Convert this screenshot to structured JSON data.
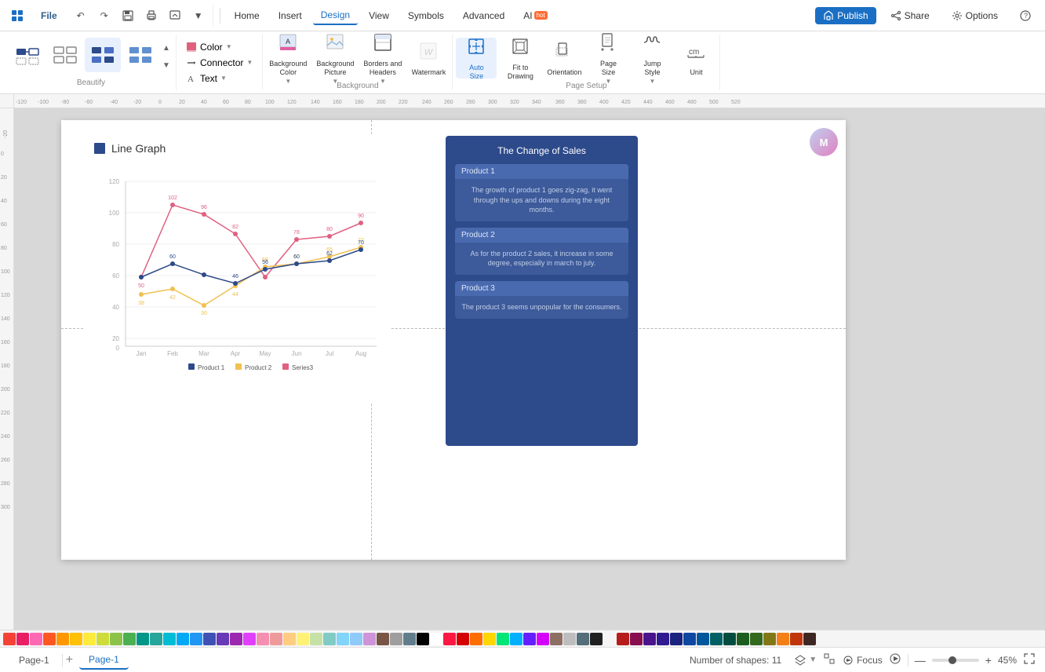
{
  "menubar": {
    "file": "File",
    "items": [
      "Home",
      "Insert",
      "Design",
      "View",
      "Symbols",
      "Advanced",
      "AI"
    ],
    "active": "Design",
    "ai_badge": "hot",
    "actions": {
      "publish": "Publish",
      "share": "Share",
      "options": "Options",
      "help": "?"
    }
  },
  "toolbar": {
    "beautify_label": "Beautify",
    "background_label": "Background",
    "page_setup_label": "Page Setup",
    "color_label": "Color",
    "connector_label": "Connector",
    "text_label": "Text",
    "bg_color_label": "Background\nColor",
    "bg_picture_label": "Background\nPicture",
    "borders_headers_label": "Borders and\nHeaders",
    "watermark_label": "Watermark",
    "auto_size_label": "Auto\nSize",
    "fit_to_drawing_label": "Fit to\nDrawing",
    "orientation_label": "Orientation",
    "page_size_label": "Page\nSize",
    "jump_style_label": "Jump\nStyle",
    "unit_label": "Unit"
  },
  "canvas": {
    "line_graph_title": "Line Graph",
    "chart": {
      "x_labels": [
        "Jan",
        "Feb",
        "Mar",
        "Apr",
        "May",
        "Jun",
        "Jul",
        "Aug"
      ],
      "y_max": 120,
      "series": [
        {
          "name": "Product 1",
          "color": "#e06080",
          "points": [
            50,
            102,
            96,
            82,
            50,
            78,
            80,
            90
          ]
        },
        {
          "name": "Product 2",
          "color": "#f0c050",
          "points": [
            38,
            42,
            30,
            44,
            58,
            60,
            65,
            72
          ]
        },
        {
          "name": "Series3",
          "color": "#c060c0",
          "points": [
            50,
            60,
            52,
            46,
            56,
            60,
            62,
            70
          ]
        }
      ]
    },
    "info_card": {
      "title": "The Change of Sales",
      "products": [
        {
          "label": "Product 1",
          "desc": "The growth of product 1 goes zig-zag, it went through the ups and downs during the eight months."
        },
        {
          "label": "Product 2",
          "desc": "As for the product 2 sales, it increase in some degree, especially in march to july."
        },
        {
          "label": "Product 3",
          "desc": "The product 3 seems unpopular for the consumers."
        }
      ]
    }
  },
  "status_bar": {
    "page_tab": "Page-1",
    "active_tab": "Page-1",
    "shapes_count": "Number of shapes: 11",
    "focus": "Focus",
    "zoom": "45%"
  },
  "colors": [
    "#f44336",
    "#e91e63",
    "#ff69b4",
    "#ff5722",
    "#ff9800",
    "#ffc107",
    "#ffeb3b",
    "#cddc39",
    "#8bc34a",
    "#4caf50",
    "#009688",
    "#26a69a",
    "#00bcd4",
    "#03a9f4",
    "#2196f3",
    "#3f51b5",
    "#673ab7",
    "#9c27b0",
    "#e040fb",
    "#f48fb1",
    "#ef9a9a",
    "#ffcc80",
    "#fff176",
    "#c5e1a5",
    "#80cbc4",
    "#81d4fa",
    "#90caf9",
    "#ce93d8",
    "#795548",
    "#9e9e9e",
    "#607d8b",
    "#000000",
    "#ffffff",
    "#ff1744",
    "#d50000",
    "#ff6d00",
    "#ffd600",
    "#00e676",
    "#00b0ff",
    "#651fff",
    "#d500f9",
    "#8d6e63",
    "#bdbdbd",
    "#546e7a",
    "#212121",
    "#f5f5f5",
    "#b71c1c",
    "#880e4f",
    "#4a148c",
    "#311b92",
    "#1a237e",
    "#0d47a1",
    "#01579b",
    "#006064",
    "#004d40",
    "#1b5e20",
    "#33691e",
    "#827717",
    "#f57f17",
    "#bf360c",
    "#3e2723"
  ]
}
